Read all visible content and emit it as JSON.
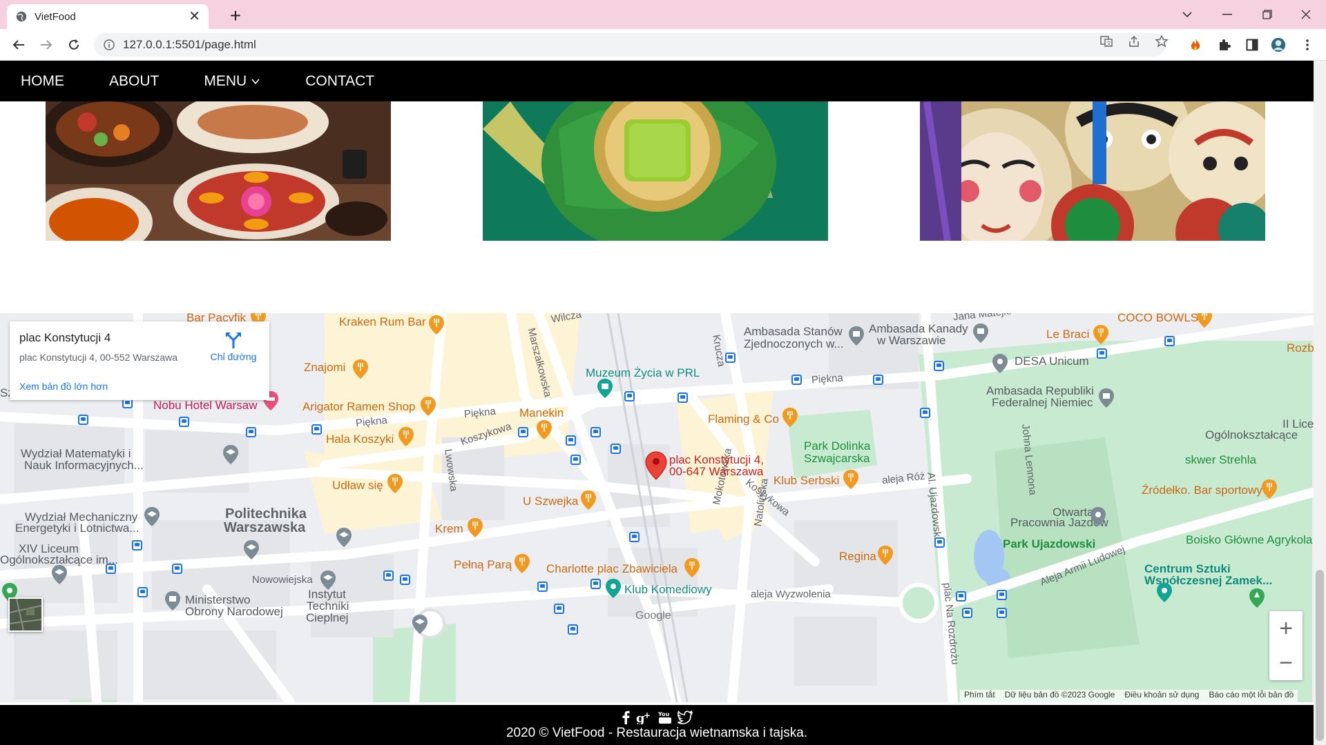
{
  "browser": {
    "tab_title": "VietFood",
    "url": "127.0.0.1:5501/page.html"
  },
  "nav": {
    "home": "HOME",
    "about": "ABOUT",
    "menu": "MENU",
    "contact": "CONTACT"
  },
  "map": {
    "card": {
      "title": "plac Konstytucji 4",
      "address": "plac Konstytucji 4, 00-552 Warszawa",
      "directions": "Chỉ đường",
      "larger_map": "Xem bản đồ lớn hơn"
    },
    "marker": {
      "line1": "plac Konstytucji 4,",
      "line2": "00-647 Warszawa"
    },
    "labels": {
      "bar_pacyfik": "Bar Pacyfik",
      "kraken": "Kraken Rum Bar",
      "wilcza": "Wilcza",
      "jana": "Jana Matejki",
      "coco": "COCO BOWLS",
      "ambasada_stanow": "Ambasada Stanów",
      "zjednoczonych": "Zjednoczonych w...",
      "ambasada_kanady": "Ambasada Kanady",
      "w_warszawie": "w Warszawie",
      "le_braci": "Le Braci",
      "rozb": "Rozb",
      "krucza": "Krucza",
      "marszalkowska": "Marszałkowska",
      "znajomi": "Znajomi",
      "muzeum": "Muzeum Życia w PRL",
      "piekna": "Piękna",
      "desa": "DESA Unicum",
      "szpital": "Szpital...",
      "nobu": "Nobu Hotel Warsaw",
      "arigator": "Arigator Ramen Shop",
      "manekin": "Manekin",
      "flaming": "Flaming & Co",
      "ambasada_niem1": "Ambasada Republiki",
      "ambasada_niem2": "Federalnej Niemiec",
      "liceum1": "II Liceu",
      "liceum2": "Ogólnokształcące",
      "piekna2": "Piękna",
      "piekna3": "Piękna",
      "koszykowa": "Koszykowa",
      "hala": "Hala Koszyki",
      "park_dolinka1": "Park Dolinka",
      "park_dolinka2": "Szwajcarska",
      "johna": "Johna Lennona",
      "wydzial_mat1": "Wydział Matematyki i",
      "wydzial_mat2": "Nauk Informacyjnych...",
      "lwowska": "Lwowska",
      "skwer": "skwer Strehla",
      "udlaw": "Udław się",
      "klub_serbski": "Klub Serbski",
      "aleja_roz": "aleja Róż",
      "al_ujazdowskie": "Al. Ujazdowskie",
      "zrodelko": "Źródełko. Bar sportowy",
      "koszykowa2": "Koszykowa",
      "u_szwejka": "U Szwejka",
      "otwarta1": "Otwarta",
      "otwarta2": "Pracownia Jazdów",
      "wydzial_mech1": "Wydział Mechaniczny",
      "wydzial_mech2": "Energetyki i Lotnictwa...",
      "politechnika1": "Politechnika",
      "politechnika2": "Warszawska",
      "mokotowska": "Mokotowska",
      "krem": "Krem",
      "natolinska": "Natolińska",
      "park_ujazdowski": "Park Ujazdowski",
      "boisko": "Boisko Główne Agrykola",
      "xiv1": "XIV Liceum",
      "xiv2": "Ogólnokształcące im...",
      "pelna": "Pełną Parą",
      "regina": "Regina",
      "aleja_armii": "Aleja Armii Ludowej",
      "charlotte": "Charlotte plac Zbawiciela",
      "centrum1": "Centrum Sztuki",
      "centrum2": "Współczesnej Zamek...",
      "nowowiejska": "Nowowiejska",
      "klub_komediowy": "Klub Komediowy",
      "aleja_wyzw": "aleja Wyzwolenia",
      "plac_na": "plac Na Rozdrożu",
      "ministerstwo1": "Ministerstwo",
      "ministerstwo2": "Obrony Narodowej",
      "instytut1": "Instytut",
      "instytut2": "Techniki",
      "instytut3": "Cieplnej",
      "google": "Google"
    },
    "attribution": {
      "shortcuts": "Phím tắt",
      "data": "Dữ liệu bản đồ ©2023 Google",
      "terms": "Điều khoản sử dụng",
      "report": "Báo cáo một lỗi bản đồ"
    },
    "zoom_in": "+",
    "zoom_out": "−"
  },
  "footer": {
    "copyright": "2020 © VietFood - Restauracja wietnamska i tajska."
  },
  "colors": {
    "tabbar": "#f6d2e1",
    "nav_bg": "#000000",
    "map_bg": "#eceef1",
    "park": "#c6e9c9",
    "road": "#ffffff",
    "highlight_area": "#fdf3d5",
    "marker": "#ea4335",
    "poi_food": "#f29a1f",
    "poi_generic": "#7d8b95",
    "transit": "#1a73e8"
  }
}
